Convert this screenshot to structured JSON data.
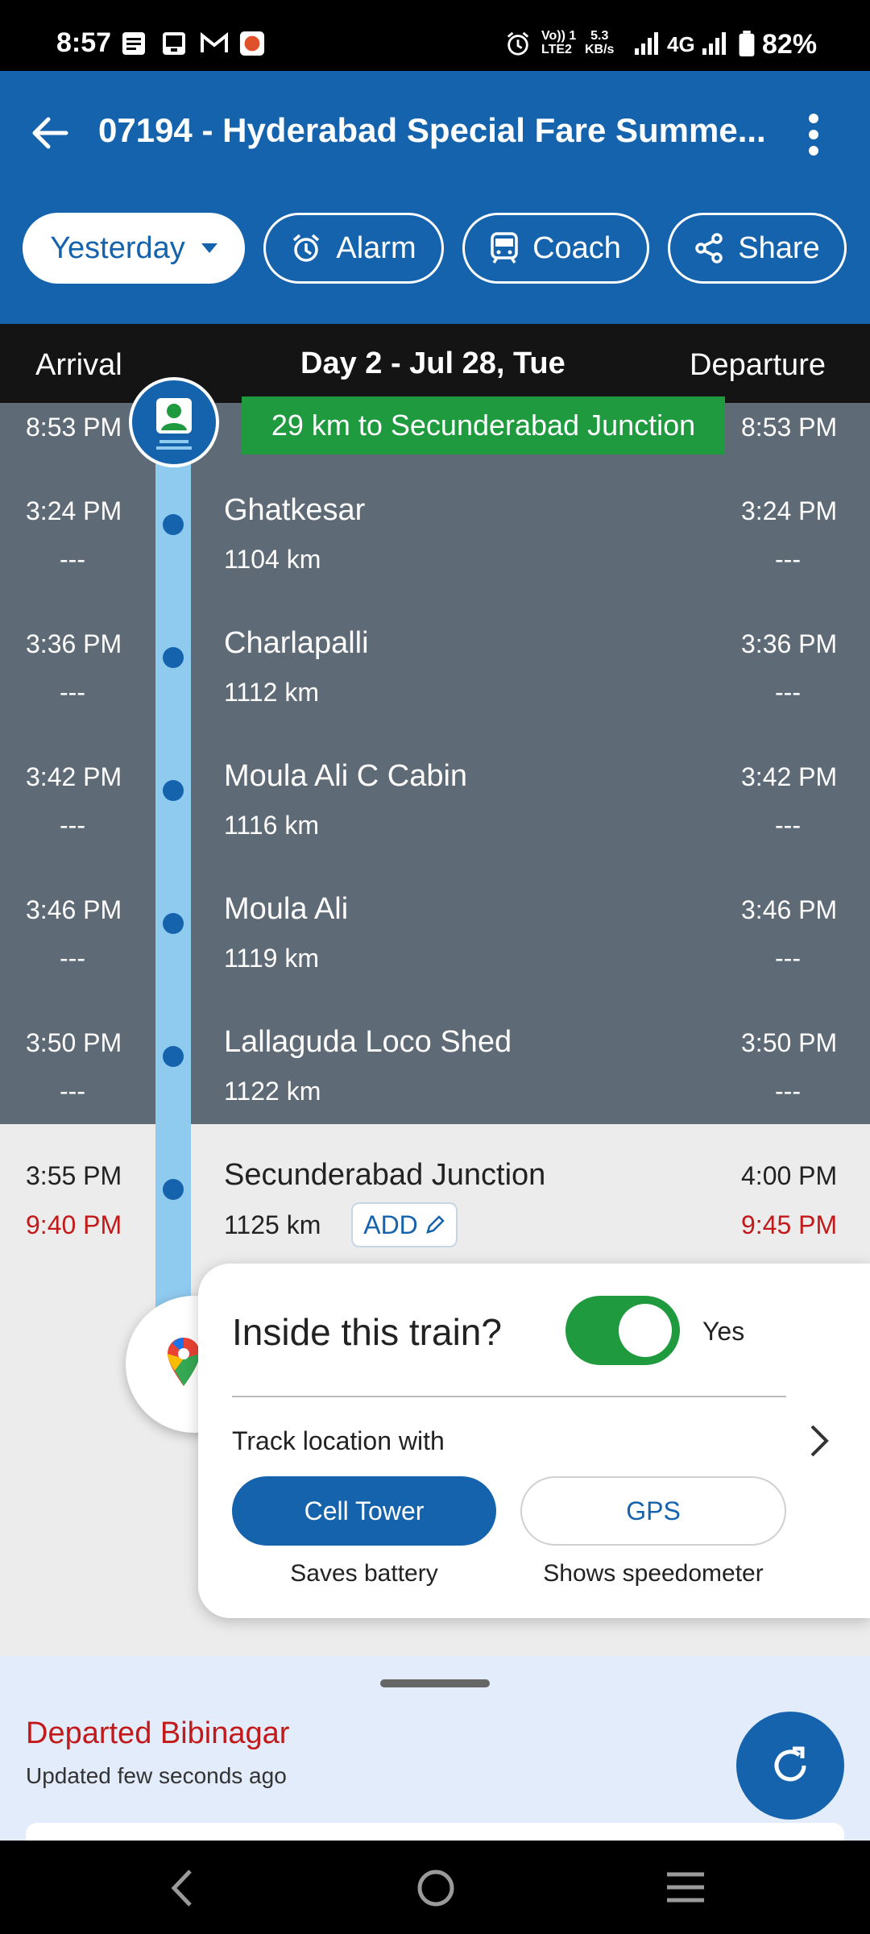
{
  "status_bar": {
    "time": "8:57",
    "net_lte": "Vo)) 1\nLTE2",
    "net_speed": "5.3\nKB/s",
    "net_type": "4G",
    "battery": "82%"
  },
  "app_bar": {
    "title": "07194 - Hyderabad Special Fare Summe...",
    "chips": {
      "yesterday": "Yesterday",
      "alarm": "Alarm",
      "coach": "Coach",
      "share": "Share"
    }
  },
  "column_header": {
    "arrival": "Arrival",
    "day": "Day 2 - Jul 28, Tue",
    "departure": "Departure"
  },
  "current": {
    "arrival": "8:53 PM",
    "departure": "8:53 PM",
    "banner": "29 km to Secunderabad Junction"
  },
  "stations": [
    {
      "name": "Ghatkesar",
      "km": "1104 km",
      "arr": "3:24 PM",
      "arr_actual": "---",
      "dep": "3:24 PM",
      "dep_actual": "---"
    },
    {
      "name": "Charlapalli",
      "km": "1112 km",
      "arr": "3:36 PM",
      "arr_actual": "---",
      "dep": "3:36 PM",
      "dep_actual": "---"
    },
    {
      "name": "Moula Ali C Cabin",
      "km": "1116 km",
      "arr": "3:42 PM",
      "arr_actual": "---",
      "dep": "3:42 PM",
      "dep_actual": "---"
    },
    {
      "name": "Moula Ali",
      "km": "1119 km",
      "arr": "3:46 PM",
      "arr_actual": "---",
      "dep": "3:46 PM",
      "dep_actual": "---"
    },
    {
      "name": "Lallaguda Loco Shed",
      "km": "1122 km",
      "arr": "3:50 PM",
      "arr_actual": "---",
      "dep": "3:50 PM",
      "dep_actual": "---"
    },
    {
      "name": "Secunderabad Junction",
      "km": "1125 km",
      "arr": "3:55 PM",
      "arr_actual": "9:40 PM",
      "dep": "4:00 PM",
      "dep_actual": "9:45 PM",
      "add_label": "ADD"
    }
  ],
  "inside_card": {
    "title": "Inside this train?",
    "toggle_label": "Yes",
    "toggle_on": true,
    "track_with": "Track location with",
    "cell_tower": "Cell Tower",
    "cell_sub": "Saves battery",
    "gps": "GPS",
    "gps_sub": "Shows speedometer"
  },
  "bottom_sheet": {
    "status": "Departed Bibinagar",
    "updated": "Updated few seconds ago"
  },
  "colors": {
    "brand_blue": "#1663ad",
    "progress_green": "#1f9a3e",
    "delay_red": "#c21a1a",
    "past_grey": "#5e6a75"
  }
}
